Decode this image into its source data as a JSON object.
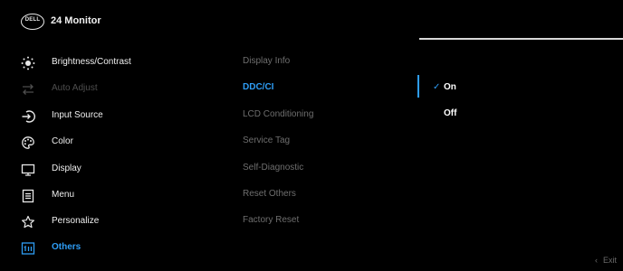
{
  "header": {
    "logo_text": "DELL",
    "title": "24 Monitor"
  },
  "menu": [
    {
      "label": "Brightness/Contrast",
      "icon": "brightness-icon",
      "state": "normal"
    },
    {
      "label": "Auto Adjust",
      "icon": "auto-adjust-icon",
      "state": "disabled"
    },
    {
      "label": "Input Source",
      "icon": "input-source-icon",
      "state": "normal"
    },
    {
      "label": "Color",
      "icon": "color-palette-icon",
      "state": "normal"
    },
    {
      "label": "Display",
      "icon": "display-icon",
      "state": "normal"
    },
    {
      "label": "Menu",
      "icon": "menu-icon",
      "state": "normal"
    },
    {
      "label": "Personalize",
      "icon": "star-icon",
      "state": "normal"
    },
    {
      "label": "Others",
      "icon": "others-icon",
      "state": "active"
    }
  ],
  "submenu": [
    {
      "label": "Display Info",
      "selected": false
    },
    {
      "label": "DDC/CI",
      "selected": true
    },
    {
      "label": "LCD Conditioning",
      "selected": false
    },
    {
      "label": "Service Tag",
      "selected": false
    },
    {
      "label": "Self-Diagnostic",
      "selected": false
    },
    {
      "label": "Reset Others",
      "selected": false
    },
    {
      "label": "Factory Reset",
      "selected": false
    }
  ],
  "options": [
    {
      "label": "On",
      "checked": true,
      "check_glyph": "✓"
    },
    {
      "label": "Off",
      "checked": false,
      "check_glyph": ""
    }
  ],
  "footer": {
    "exit_label": "Exit",
    "exit_icon": "chevron-left-icon",
    "chevron_glyph": "‹"
  },
  "colors": {
    "accent": "#2e9df5",
    "background": "#000000",
    "disabled_text": "#4e4e4e",
    "submenu_text": "#6e6e6e"
  }
}
